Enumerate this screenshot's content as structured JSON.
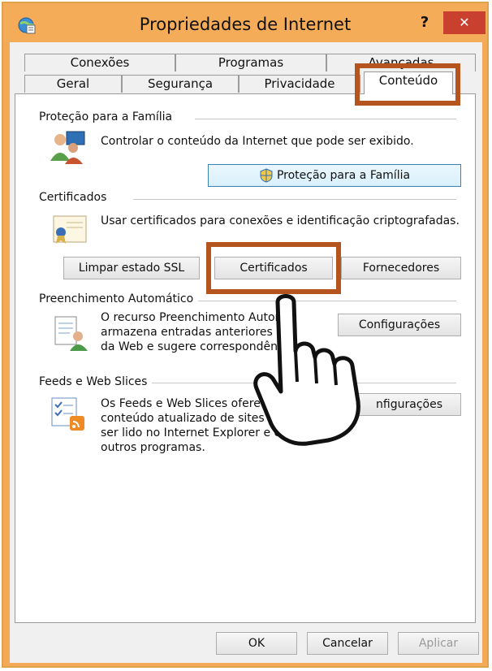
{
  "window": {
    "title": "Propriedades de Internet",
    "help": "?",
    "close": "✕"
  },
  "tabs": {
    "row1": [
      "Conexões",
      "Programas",
      "Avançadas"
    ],
    "row2": [
      "Geral",
      "Segurança",
      "Privacidade",
      "Conteúdo"
    ],
    "active": "Conteúdo"
  },
  "family_safety": {
    "title": "Proteção para a Família",
    "description": "Controlar o conteúdo da Internet que pode ser exibido.",
    "button": "Proteção para a Família"
  },
  "certificates": {
    "title": "Certificados",
    "description": "Usar certificados para conexões e identificação criptografadas.",
    "clear_ssl_button": "Limpar estado SSL",
    "certificates_button": "Certificados",
    "publishers_button": "Fornecedores"
  },
  "autocomplete": {
    "title": "Preenchimento Automático",
    "lines": [
      "O recurso Preenchimento Autom",
      "armazena entradas anteriores e",
      "da Web e sugere correspondênci"
    ],
    "button": "Configurações"
  },
  "feeds": {
    "title": "Feeds e Web Slices",
    "lines": [
      "Os Feeds e Web Slices oferecem",
      "conteúdo atualizado de sites que po",
      "ser lido no Internet Explorer e em",
      "outros programas."
    ],
    "button": "nfigurações"
  },
  "footer": {
    "ok": "OK",
    "cancel": "Cancelar",
    "apply": "Aplicar"
  },
  "colors": {
    "highlight": "#b5541f",
    "titlebar": "#f5ac58",
    "close": "#c9402f"
  }
}
